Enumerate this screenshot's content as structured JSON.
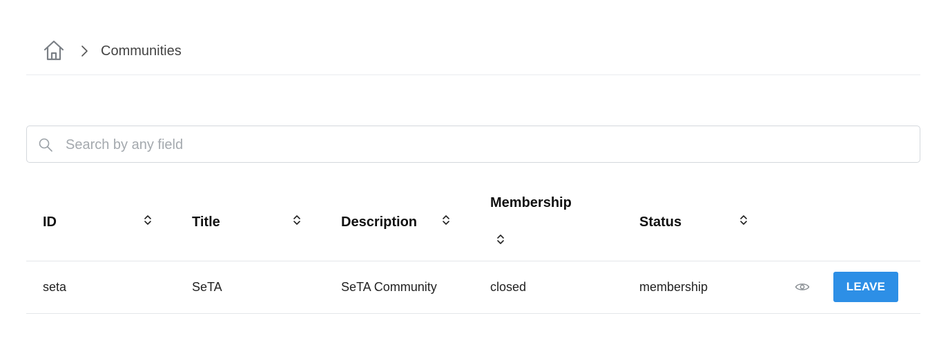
{
  "breadcrumb": {
    "home_icon": "home-icon",
    "separator_icon": "chevron-right-icon",
    "current": "Communities"
  },
  "search": {
    "placeholder": "Search by any field",
    "value": "",
    "icon": "search-icon"
  },
  "table": {
    "columns": [
      {
        "key": "id",
        "label": "ID"
      },
      {
        "key": "title",
        "label": "Title"
      },
      {
        "key": "description",
        "label": "Description"
      },
      {
        "key": "membership",
        "label": "Membership"
      },
      {
        "key": "status",
        "label": "Status"
      }
    ],
    "rows": [
      {
        "id": "seta",
        "title": "SeTA",
        "description": "SeTA Community",
        "membership": "closed",
        "status": "membership",
        "view_icon": "eye-icon",
        "action_label": "LEAVE"
      }
    ]
  },
  "colors": {
    "accent": "#2d8fe6",
    "border": "#e3e6e9",
    "placeholder": "#a4a9ae"
  }
}
